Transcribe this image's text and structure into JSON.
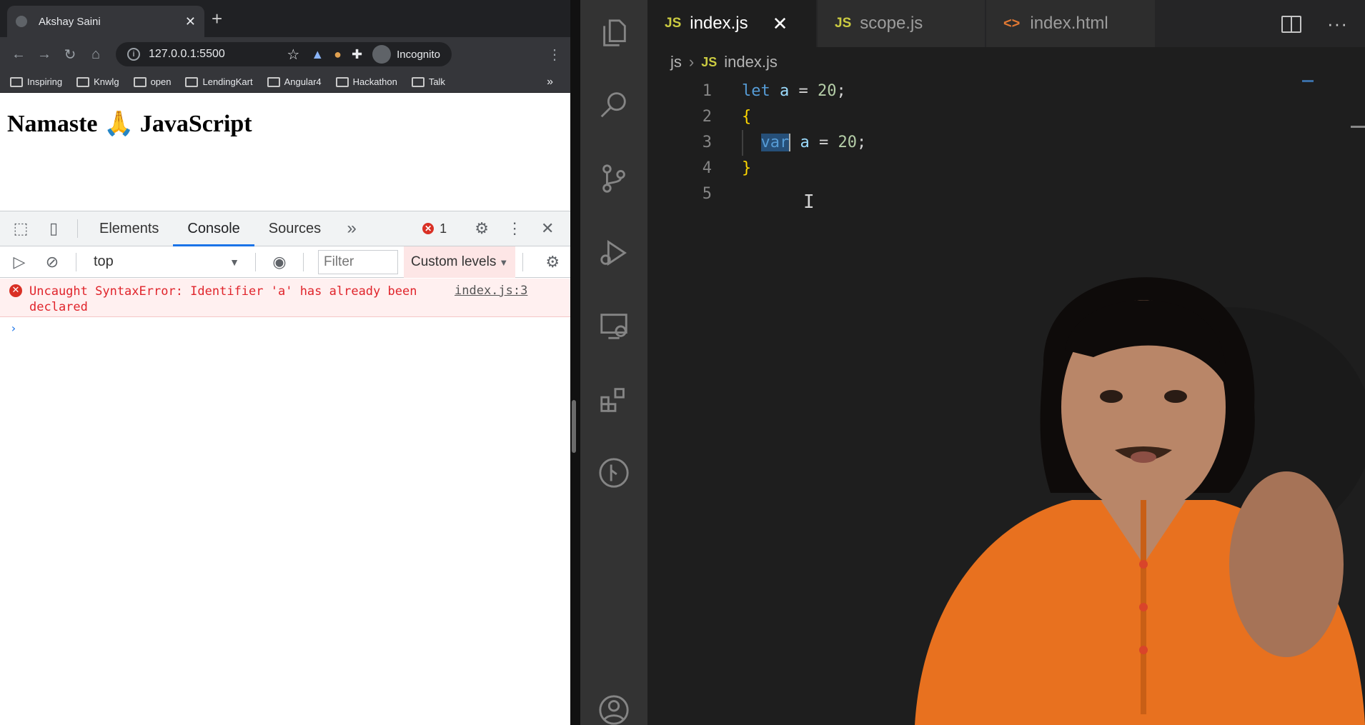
{
  "browser": {
    "tab_title": "Akshay Saini",
    "url": "127.0.0.1:5500",
    "incognito_label": "Incognito",
    "bookmarks": [
      "Inspiring",
      "Knwlg",
      "open",
      "LendingKart",
      "Angular4",
      "Hackathon",
      "Talk"
    ],
    "page_heading": "Namaste 🙏 JavaScript"
  },
  "devtools": {
    "tabs": [
      "Elements",
      "Console",
      "Sources"
    ],
    "active_tab": "Console",
    "error_count": "1",
    "context": "top",
    "filter_placeholder": "Filter",
    "levels_label": "Custom levels",
    "error_message": "Uncaught SyntaxError: Identifier 'a' has already been declared",
    "error_source": "index.js:3",
    "prompt": "›"
  },
  "vscode": {
    "tabs": [
      {
        "icon": "JS",
        "name": "index.js",
        "active": true
      },
      {
        "icon": "JS",
        "name": "scope.js",
        "active": false
      },
      {
        "icon": "<>",
        "name": "index.html",
        "active": false
      }
    ],
    "breadcrumb": {
      "folder": "js",
      "file_icon": "JS",
      "file": "index.js"
    },
    "lines": [
      {
        "n": "1",
        "keyword": "let",
        "ident": "a",
        "op": " = ",
        "value": "20",
        "end": ";"
      },
      {
        "n": "2",
        "text": "{"
      },
      {
        "n": "3",
        "keyword": "var",
        "ident": "a",
        "op": " = ",
        "value": "20",
        "end": ";"
      },
      {
        "n": "4",
        "text": "}"
      },
      {
        "n": "5",
        "text": ""
      }
    ]
  },
  "colors": {
    "keyword": "#569cd6",
    "identifier": "#9cdcfe",
    "number": "#b5cea8",
    "brace": "#ffd700",
    "error": "#e0242b",
    "accent": "#1a73e8"
  },
  "icons": [
    "files-icon",
    "search-icon",
    "source-control-icon",
    "run-debug-icon",
    "remote-explorer-icon",
    "extensions-icon",
    "git-graph-icon",
    "account-icon"
  ]
}
